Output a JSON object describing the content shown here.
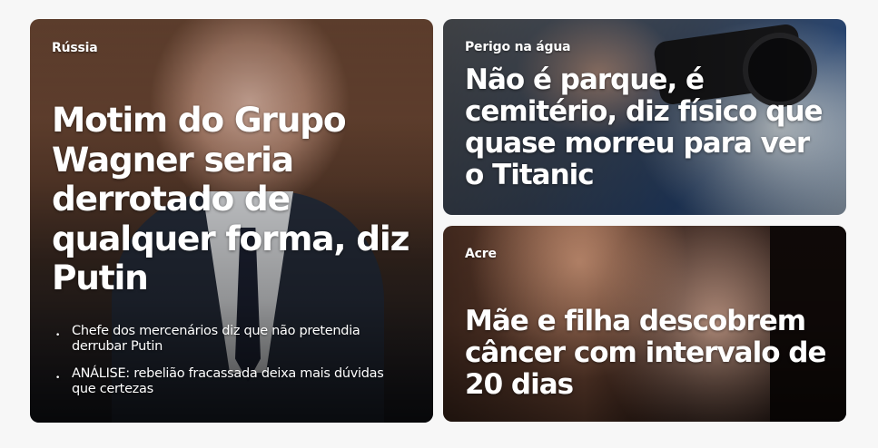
{
  "cards": [
    {
      "kicker": "Rússia",
      "headline": "Motim do Grupo Wagner seria derrotado de qualquer forma, diz Putin",
      "bullets": [
        "Chefe dos mercenários diz que não pretendia derrubar Putin",
        "ANÁLISE: rebelião fracassada deixa mais dúvidas que certezas"
      ]
    },
    {
      "kicker": "Perigo na água",
      "headline": "Não é parque, é cemitério, diz físico que quase morreu para ver o Titanic"
    },
    {
      "kicker": "Acre",
      "headline": "Mãe e filha descobrem câncer com intervalo de 20 dias"
    }
  ],
  "bullet_glyph": "•"
}
